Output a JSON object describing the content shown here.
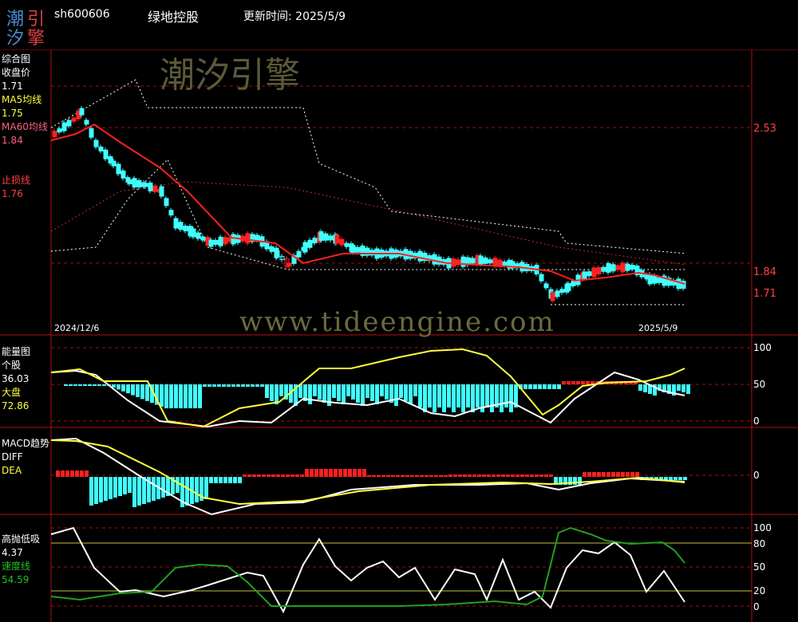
{
  "header": {
    "logo_chars": [
      "潮",
      "汐",
      "引",
      "擎"
    ],
    "stock_code": "sh600606",
    "stock_name": "绿地控股",
    "update_time_label": "更新时间: 2025/5/9"
  },
  "watermark": {
    "brand": "潮汐引擎",
    "url": "www.tideengine.com"
  },
  "panels": {
    "main": {
      "title": "综合图",
      "close_label": "收盘价",
      "close_value": "1.71",
      "ma5_label": "MA5均线",
      "ma5_value": "1.75",
      "ma60_label": "MA60均线",
      "ma60_value": "1.84",
      "stop_label": "止损线",
      "stop_value": "1.76",
      "axis_labels": [
        "2.53",
        "1.84",
        "1.71"
      ],
      "date_start": "2024/12/6",
      "date_end": "2025/5/9"
    },
    "energy": {
      "title": "能量图",
      "stock_label": "个股",
      "stock_value": "36.03",
      "market_label": "大盘",
      "market_value": "72.86",
      "axis_labels": [
        "100",
        "50",
        "0"
      ]
    },
    "macd": {
      "title": "MACD趋势",
      "diff_label": "DIFF",
      "dea_label": "DEA",
      "axis_labels": [
        "0"
      ]
    },
    "hilo": {
      "title": "高抛低吸",
      "value": "4.37",
      "speed_label": "速度线",
      "speed_value": "54.59",
      "axis_labels": [
        "100",
        "80",
        "50",
        "20",
        "0"
      ]
    }
  },
  "colors": {
    "up": "#ff2020",
    "down": "#40ffff",
    "grid": "#a01010",
    "ma": "#ff2020",
    "white_line": "#ffffff",
    "yellow_line": "#ffff40",
    "green_line": "#20a020",
    "label_red": "#ff4040",
    "label_yellow": "#ffff40",
    "label_green": "#20c020"
  }
}
